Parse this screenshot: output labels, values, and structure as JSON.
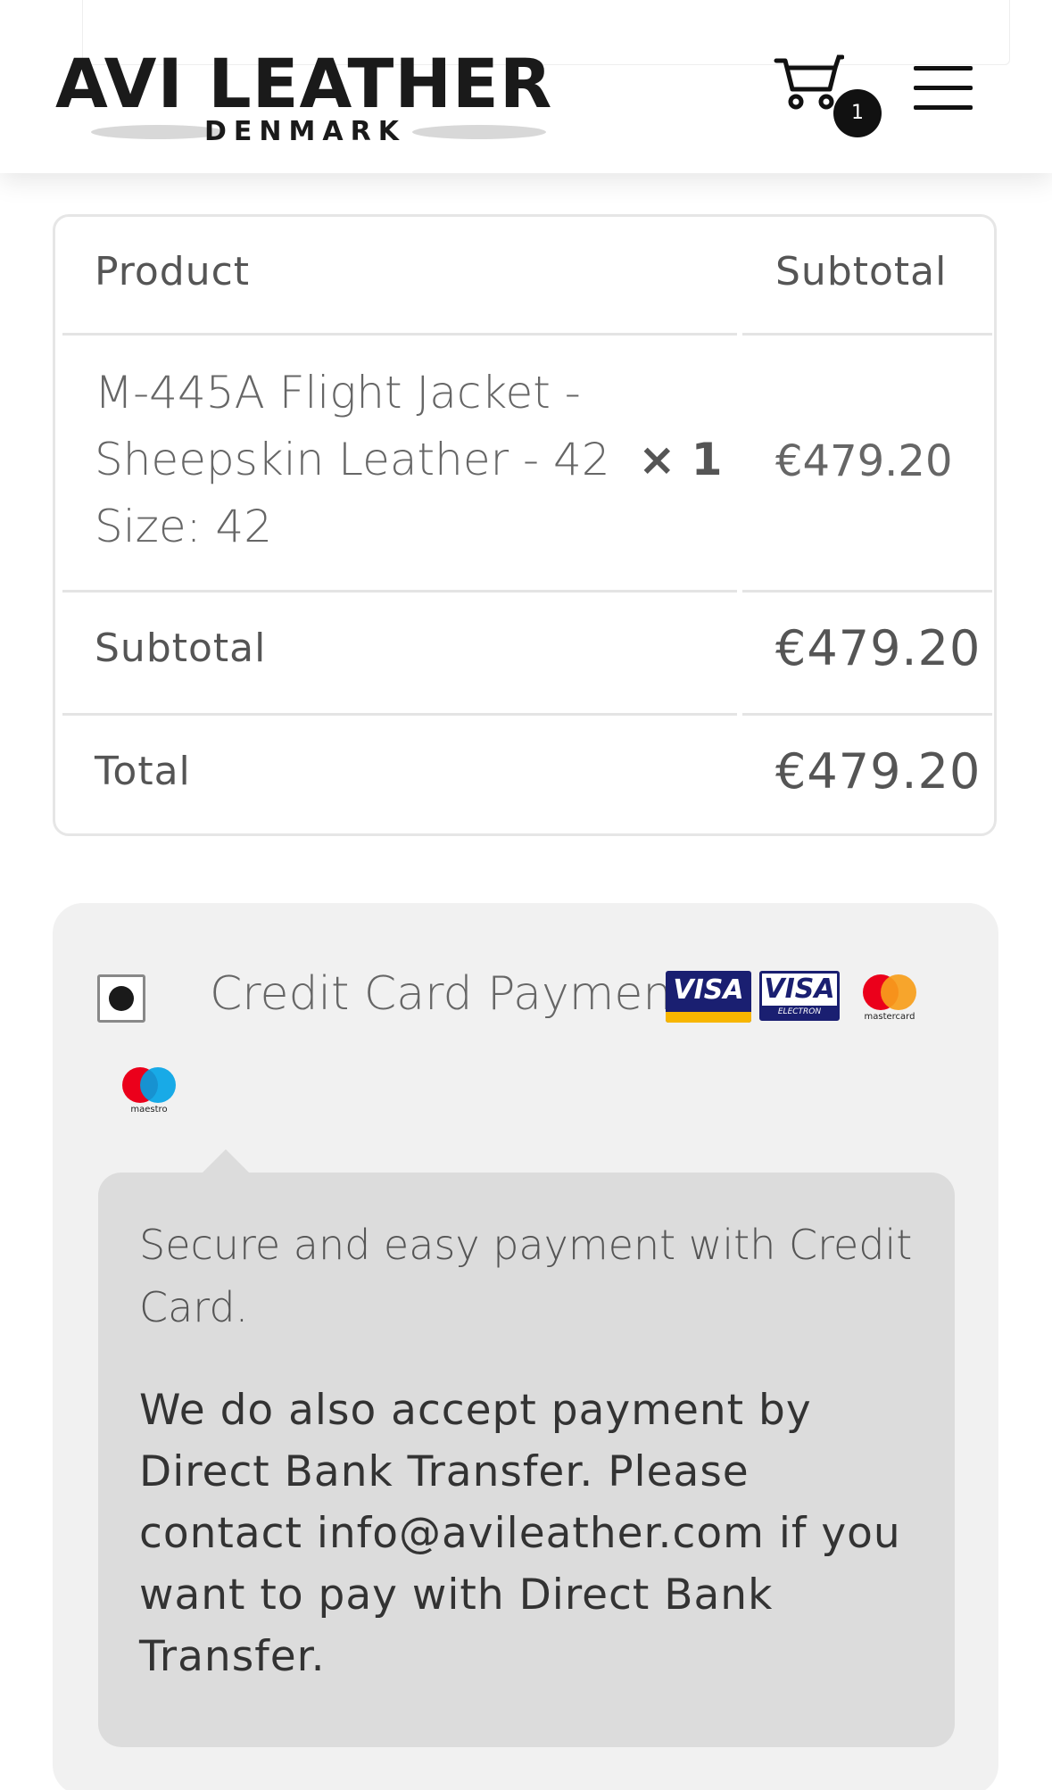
{
  "header": {
    "logo_main": "AVI LEATHER",
    "logo_sub": "DENMARK",
    "cart_count": "1",
    "cart_icon": "cart-icon",
    "menu_icon": "hamburger-menu-icon"
  },
  "order": {
    "col_product": "Product",
    "col_subtotal": "Subtotal",
    "items": [
      {
        "name_line1": "M-445A Flight Jacket -",
        "name_line2": "Sheepskin Leather - 42",
        "qty": "× 1",
        "meta": "Size: 42",
        "price": "€479.20"
      }
    ],
    "subtotal_label": "Subtotal",
    "subtotal_value": "€479.20",
    "total_label": "Total",
    "total_value": "€479.20"
  },
  "payment": {
    "method_label": "Credit Card Payment",
    "selected": true,
    "cards": [
      "VISA",
      "VISA",
      "mastercard",
      "maestro"
    ],
    "visa_electron_sub": "ELECTRON",
    "description_1": "Secure and easy payment with Credit Card.",
    "description_2": "We do also accept payment by Direct Bank Transfer. Please contact info@avileather.com if you want to pay with Direct Bank Transfer."
  }
}
